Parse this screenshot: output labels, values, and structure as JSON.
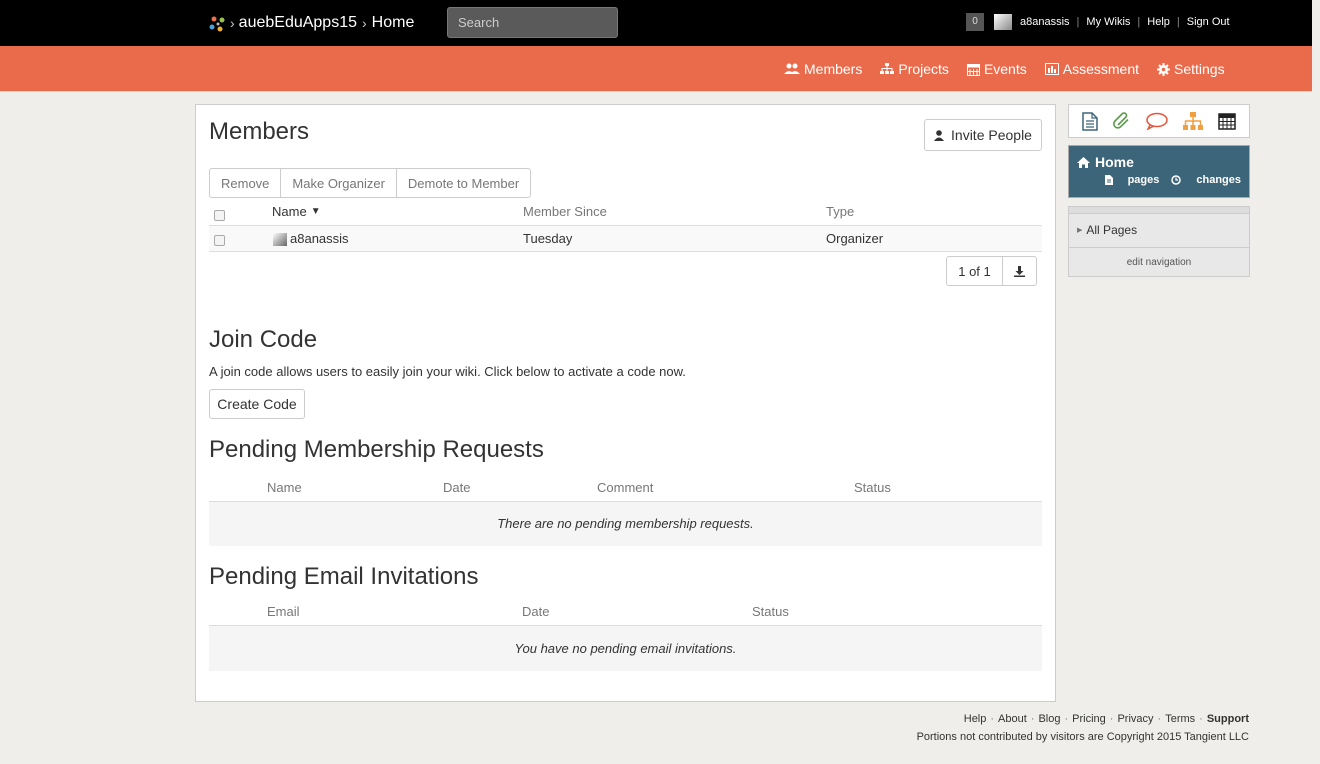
{
  "topbar": {
    "site": "auebEduApps15",
    "page": "Home",
    "search_placeholder": "Search",
    "notif_count": "0",
    "username": "a8anassis",
    "links": [
      "My Wikis",
      "Help",
      "Sign Out"
    ]
  },
  "nav": {
    "members": "Members",
    "projects": "Projects",
    "events": "Events",
    "assessment": "Assessment",
    "settings": "Settings"
  },
  "members_section": {
    "title": "Members",
    "invite_label": "Invite People",
    "actions": [
      "Remove",
      "Make Organizer",
      "Demote to Member"
    ],
    "columns": [
      "Name",
      "Member Since",
      "Type"
    ],
    "rows": [
      {
        "name": "a8anassis",
        "since": "Tuesday",
        "type": "Organizer"
      }
    ],
    "pager": "1 of 1"
  },
  "join_code": {
    "title": "Join Code",
    "text": "A join code allows users to easily join your wiki. Click below to activate a code now.",
    "button": "Create Code"
  },
  "pending_requests": {
    "title": "Pending Membership Requests",
    "columns": [
      "Name",
      "Date",
      "Comment",
      "Status"
    ],
    "empty": "There are no pending membership requests."
  },
  "pending_invites": {
    "title": "Pending Email Invitations",
    "columns": [
      "Email",
      "Date",
      "Status"
    ],
    "empty": "You have no pending email invitations."
  },
  "sidebar": {
    "home": "Home",
    "pages_link": "pages",
    "changes_link": "changes",
    "all_pages": "All Pages",
    "edit_nav": "edit navigation"
  },
  "footer": {
    "links": [
      "Help",
      "About",
      "Blog",
      "Pricing",
      "Privacy",
      "Terms",
      "Support"
    ],
    "copyright": "Portions not contributed by visitors are Copyright 2015 Tangient LLC"
  },
  "colors": {
    "topbar": "#000000",
    "navbar": "#ea6b4b",
    "home_box": "#3d6579"
  }
}
